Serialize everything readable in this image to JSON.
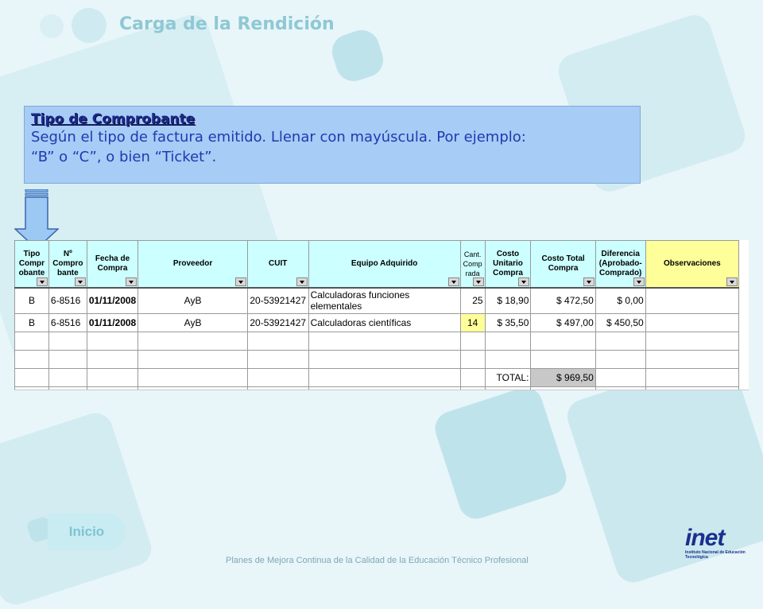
{
  "slide": {
    "title": "Carga de la Rendición",
    "nav_button": "Inicio",
    "footer": "Planes de Mejora Continua de la Calidad de la Educación Técnico Profesional"
  },
  "callout": {
    "title": "Tipo de Comprobante",
    "line1": "Según el tipo de factura emitido. Llenar con mayúscula. Por ejemplo:",
    "line2": "“B” o “C”, o bien “Ticket”."
  },
  "table": {
    "headers": [
      "Tipo Compr obante",
      "Nº Compro bante",
      "Fecha de Compra",
      "Proveedor",
      "CUIT",
      "Equipo Adquirido",
      "Cant. Comp rada",
      "Costo Unitario Compra",
      "Costo Total Compra",
      "Diferencia (Aprobado-Comprado)",
      "Observaciones"
    ],
    "rows": [
      {
        "tipo": "B",
        "numero": "6-8516",
        "fecha": "01/11/2008",
        "proveedor": "AyB",
        "cuit": "20-53921427",
        "equipo": "Calculadoras funciones elementales",
        "cantidad": "25",
        "unitario": "$ 18,90",
        "total": "$ 472,50",
        "diferencia": "$ 0,00",
        "observaciones": ""
      },
      {
        "tipo": "B",
        "numero": "6-8516",
        "fecha": "01/11/2008",
        "proveedor": "AyB",
        "cuit": "20-53921427",
        "equipo": "Calculadoras científicas",
        "cantidad": "14",
        "unitario": "$ 35,50",
        "total": "$ 497,00",
        "diferencia": "$ 450,50",
        "observaciones": ""
      }
    ],
    "total_label": "TOTAL:",
    "total_value": "$ 969,50"
  },
  "logo": {
    "word": "inet",
    "subtitle": "Instituto Nacional de Educación Tecnológica"
  },
  "colors": {
    "background": "#e8f6f9",
    "callout_bg": "#a7ccf6",
    "header_bg": "#ccffff",
    "observaciones_bg": "#ffff99",
    "highlight_cell": "#ffff99",
    "total_cell": "#c8c8c8"
  }
}
